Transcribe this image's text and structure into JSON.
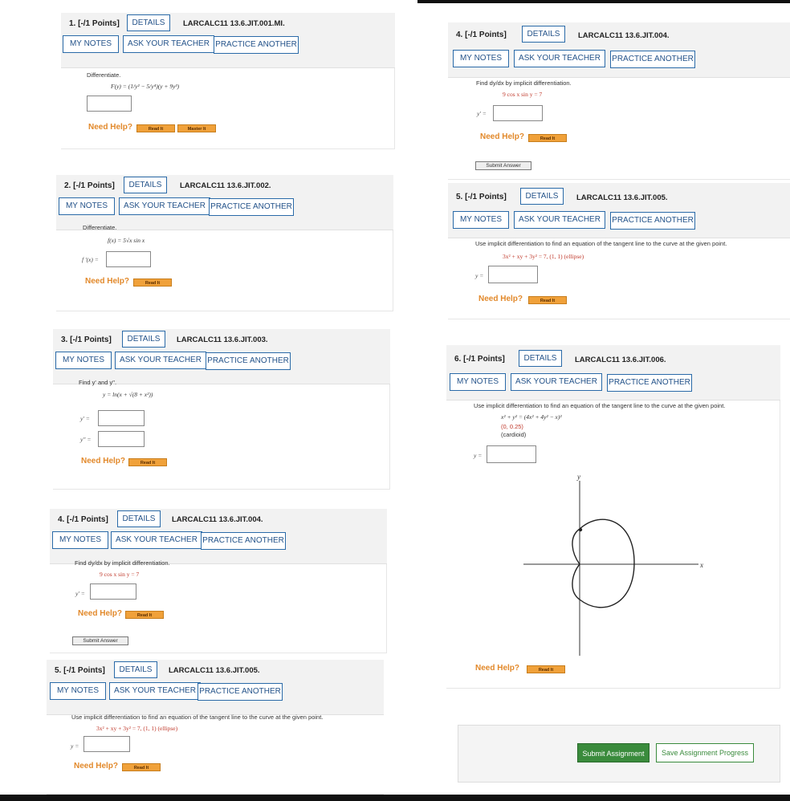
{
  "common": {
    "details": "DETAILS",
    "my_notes": "MY NOTES",
    "ask_teacher": "ASK YOUR TEACHER",
    "practice": "PRACTICE ANOTHER",
    "need_help": "Need Help?",
    "read_it": "Read It",
    "master_it": "Master It",
    "submit_answer": "Submit Answer"
  },
  "q1": {
    "num": "1. [-/1 Points]",
    "code": "LARCALC11 13.6.JIT.001.MI.",
    "prompt": "Differentiate.",
    "equation": "F(y) = (1/y² − 5/y⁴)(y + 9y³)"
  },
  "q2": {
    "num": "2. [-/1 Points]",
    "code": "LARCALC11 13.6.JIT.002.",
    "prompt": "Differentiate.",
    "equation": "f(x) = 5√x sin x",
    "answer_label": "f '(x) ="
  },
  "q3": {
    "num": "3. [-/1 Points]",
    "code": "LARCALC11 13.6.JIT.003.",
    "prompt": "Find y' and y\".",
    "equation": "y = ln(x + √(8 + x²))",
    "label1": "y' =",
    "label2": "y\" ="
  },
  "q4": {
    "num": "4. [-/1 Points]",
    "code": "LARCALC11 13.6.JIT.004.",
    "prompt": "Find dy/dx by implicit differentiation.",
    "equation": "9 cos x sin y = 7",
    "answer_label": "y' ="
  },
  "q5": {
    "num": "5. [-/1 Points]",
    "code": "LARCALC11 13.6.JIT.005.",
    "prompt": "Use implicit differentiation to find an equation of the tangent line to the curve at the given point.",
    "equation": "3x² + xy + 3y² = 7,  (1, 1)  (ellipse)",
    "answer_label": "y ="
  },
  "q6": {
    "num": "6. [-/1 Points]",
    "code": "LARCALC11 13.6.JIT.006.",
    "prompt": "Use implicit differentiation to find an equation of the tangent line to the curve at the given point.",
    "equation": "x² + y² = (4x² + 4y² − x)²",
    "point": "(0, 0.25)",
    "curve": "(cardioid)",
    "answer_label": "y =",
    "graph_x": "x",
    "graph_y": "y"
  },
  "actions": {
    "submit_assignment": "Submit Assignment",
    "save_progress": "Save Assignment Progress"
  }
}
